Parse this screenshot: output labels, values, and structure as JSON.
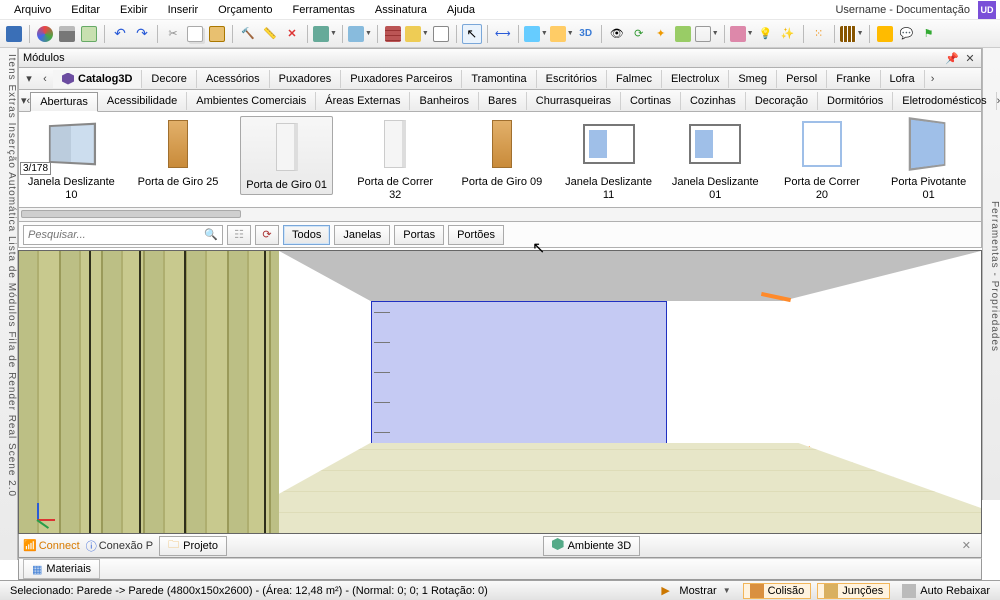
{
  "menu": {
    "items": [
      "Arquivo",
      "Editar",
      "Exibir",
      "Inserir",
      "Orçamento",
      "Ferramentas",
      "Assinatura",
      "Ajuda"
    ],
    "user": "Username - Documentação",
    "badge": "UD"
  },
  "panel": {
    "title": "Módulos"
  },
  "catalog_tabs": {
    "nav_prev": "‹",
    "nav_first": "«",
    "items": [
      "Catalog3D",
      "Decore",
      "Acessórios",
      "Puxadores",
      "Puxadores Parceiros",
      "Tramontina",
      "Escritórios",
      "Falmec",
      "Electrolux",
      "Smeg",
      "Persol",
      "Franke",
      "Lofra"
    ],
    "nav_next": "›"
  },
  "category_tabs": {
    "items": [
      "Aberturas",
      "Acessibilidade",
      "Ambientes Comerciais",
      "Áreas Externas",
      "Banheiros",
      "Bares",
      "Churrasqueiras",
      "Cortinas",
      "Cozinhas",
      "Decoração",
      "Dormitórios",
      "Eletrodomésticos"
    ],
    "active_index": 0,
    "nav_prev": "‹",
    "nav_next": "›"
  },
  "counter": "3/178",
  "gallery": [
    {
      "label": "Janela Deslizante 10",
      "kind": "window"
    },
    {
      "label": "Porta de Giro 25",
      "kind": "door"
    },
    {
      "label": "Porta de Giro 01",
      "kind": "door-w",
      "selected": true
    },
    {
      "label": "Porta de Correr 32",
      "kind": "door-w"
    },
    {
      "label": "Porta de Giro 09",
      "kind": "door"
    },
    {
      "label": "Janela Deslizante 11",
      "kind": "slide"
    },
    {
      "label": "Janela Deslizante 01",
      "kind": "slide"
    },
    {
      "label": "Porta de Correr 20",
      "kind": "correr"
    },
    {
      "label": "Porta Pivotante 01",
      "kind": "pivot"
    }
  ],
  "search": {
    "placeholder": "Pesquisar..."
  },
  "filters": [
    "Todos",
    "Janelas",
    "Portas",
    "Portões"
  ],
  "filters_selected": 0,
  "doc_tabs": {
    "connect": "Connect",
    "conexao": "Conexão P",
    "projeto": "Projeto",
    "ambiente": "Ambiente 3D"
  },
  "materials_tab": "Materiais",
  "left_rail": "Itens Extras      Inserção Automática      Lista de Módulos      Fila de Render      Real Scene 2.0",
  "right_rail": "Ferramentas - Propriedades",
  "status": {
    "selection": "Selecionado: Parede -> Parede (4800x150x2600) - (Área: 12,48 m²) - (Normal: 0; 0; 1 Rotação: 0)",
    "mostrar": "Mostrar",
    "colisao": "Colisão",
    "juncoes": "Junções",
    "auto": "Auto Rebaixar"
  }
}
